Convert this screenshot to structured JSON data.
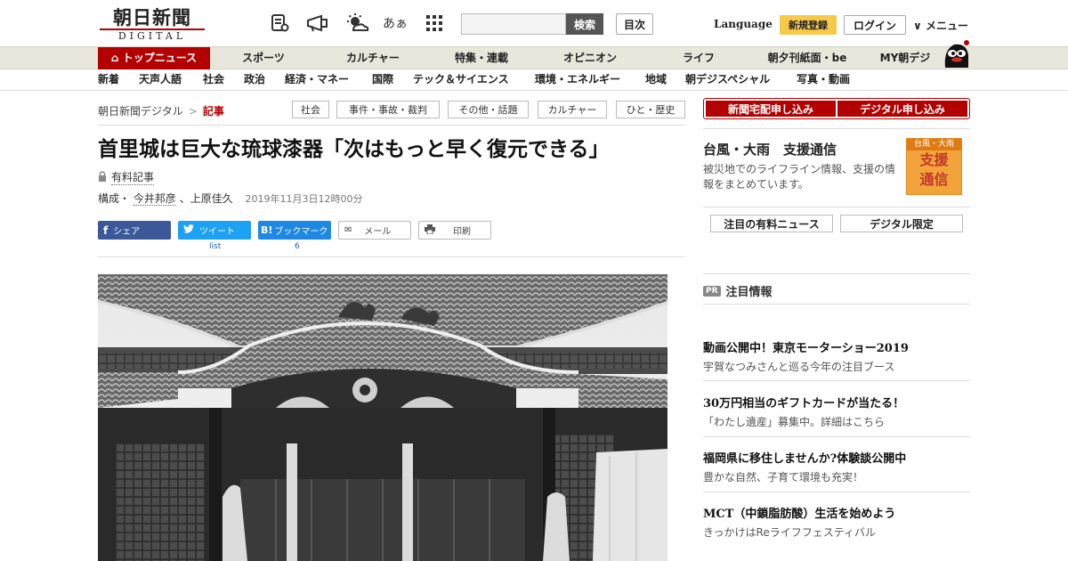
{
  "header": {
    "logo_main": "朝日新聞",
    "logo_sub": "DIGITAL",
    "icons": [
      "newspaper-icon",
      "megaphone-icon",
      "weather-icon",
      "font-size-icon",
      "grid-icon"
    ],
    "font_size_glyph": "あぁ",
    "search_placeholder": "",
    "search_button": "検索",
    "index_button": "目次",
    "language": "Language",
    "register": "新規登録",
    "login": "ログイン",
    "menu": "メニュー"
  },
  "nav_main": [
    {
      "label": "トップニュース",
      "active": true
    },
    {
      "label": "スポーツ"
    },
    {
      "label": "カルチャー"
    },
    {
      "label": "特集・連載"
    },
    {
      "label": "オピニオン"
    },
    {
      "label": "ライフ"
    },
    {
      "label": "朝夕刊紙面・be"
    },
    {
      "label": "MY朝デジ"
    }
  ],
  "nav_sub": [
    "新着",
    "天声人語",
    "社会",
    "政治",
    "経済・マネー",
    "国際",
    "テック＆サイエンス",
    "環境・エネルギー",
    "地域",
    "朝デジスペシャル",
    "写真・動画"
  ],
  "breadcrumb": {
    "home": "朝日新聞デジタル",
    "sep": ">",
    "current": "記事"
  },
  "tags": [
    "社会",
    "事件・事故・裁判",
    "その他・話題",
    "カルチャー",
    "ひと・歴史"
  ],
  "article": {
    "title": "首里城は巨大な琉球漆器「次はもっと早く復元できる」",
    "paid_label": "有料記事",
    "byline_prefix": "構成・",
    "author1": "今井邦彦",
    "separator": "、",
    "author2": "上原佳久",
    "date": "2019年11月3日12時00分"
  },
  "share": {
    "facebook": "シェア",
    "twitter": "ツイート",
    "twitter_count": "list",
    "hatena": "ブックマーク",
    "hatena_count": "6",
    "hatena_logo": "B!",
    "mail": "メール",
    "print": "印刷"
  },
  "sidebar": {
    "delivery": "新聞宅配申し込み",
    "digital": "デジタル申し込み",
    "typhoon_title": "台風・大雨　支援通信",
    "typhoon_desc": "被災地でのライフライン情報、支援の情報をまとめています。",
    "badge_top": "台風・大雨",
    "badge_line1": "支援",
    "badge_line2": "通信",
    "btn_paid_news": "注目の有料ニュース",
    "btn_digital_only": "デジタル限定",
    "pr_badge": "PR",
    "pr_heading": "注目情報",
    "pr_items": [
      {
        "title": "動画公開中！東京モーターショー2019",
        "desc": "宇賀なつみさんと巡る今年の注目ブース"
      },
      {
        "title": "30万円相当のギフトカードが当たる！",
        "desc": "「わたし遺産」募集中。詳細はこちら"
      },
      {
        "title": "福岡県に移住しませんか?体験談公開中",
        "desc": "豊かな自然、子育て環境も充実！"
      },
      {
        "title": "MCT（中鎖脂肪酸）生活を始めよう",
        "desc": "きっかけはReライフフェスティバル"
      }
    ]
  },
  "colors": {
    "brand_red": "#b30000",
    "nav_bg": "#e9e6dc",
    "register_yellow": "#f7c94a"
  }
}
